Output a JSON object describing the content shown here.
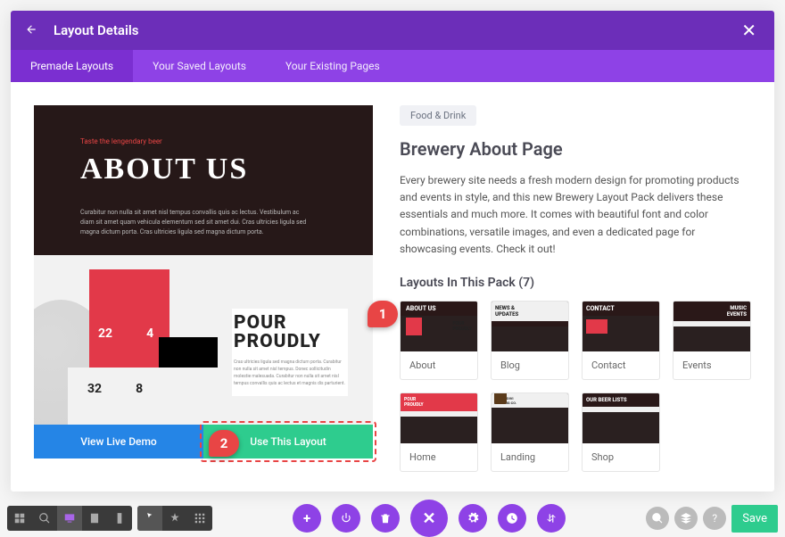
{
  "header": {
    "title": "Layout Details"
  },
  "tabs": [
    {
      "label": "Premade Layouts",
      "active": true
    },
    {
      "label": "Your Saved Layouts",
      "active": false
    },
    {
      "label": "Your Existing Pages",
      "active": false
    }
  ],
  "preview": {
    "taste": "Taste the lengendary beer",
    "about": "ABOUT US",
    "lorem": "Curabitur non nulla sit amet nisl tempus convallis quis ac lectus. Vestibulum ac diam sit amet quam vehicula elementum sed sit amet dui. Cras ultricies ligula sed magna dictum porta. Cras ultricies ligula sed magna dictum porta.",
    "n1": "22",
    "n2": "4",
    "n3": "32",
    "n4": "8",
    "pour": "POUR PROUDLY",
    "pourdesc": "Cras ultricies ligula sed magna dictum porta. Curabitur non nulla sit amet nisl tempus. Donec sollicitudin molestie malesuada. Curabitur non nulla sit amet nisl tempus convallis quis ac lectus et magnis dis parturient."
  },
  "buttons": {
    "demo": "View Live Demo",
    "use": "Use This Layout"
  },
  "category": "Food & Drink",
  "pageTitle": "Brewery About Page",
  "description": "Every brewery site needs a fresh modern design for promoting products and events in style, and this new Brewery Layout Pack delivers these essentials and much more. It comes with beautiful font and color combinations, versatile images, and even a dedicated page for showcasing events. Check it out!",
  "packTitle": "Layouts In This Pack (7)",
  "layouts": [
    {
      "label": "About",
      "thumb": "about",
      "selected": true
    },
    {
      "label": "Blog",
      "thumb": "blog"
    },
    {
      "label": "Contact",
      "thumb": "contact"
    },
    {
      "label": "Events",
      "thumb": "events"
    },
    {
      "label": "Home",
      "thumb": "home"
    },
    {
      "label": "Landing",
      "thumb": "landing"
    },
    {
      "label": "Shop",
      "thumb": "shop"
    }
  ],
  "markers": {
    "m1": "1",
    "m2": "2"
  },
  "toolbar": {
    "save": "Save"
  }
}
